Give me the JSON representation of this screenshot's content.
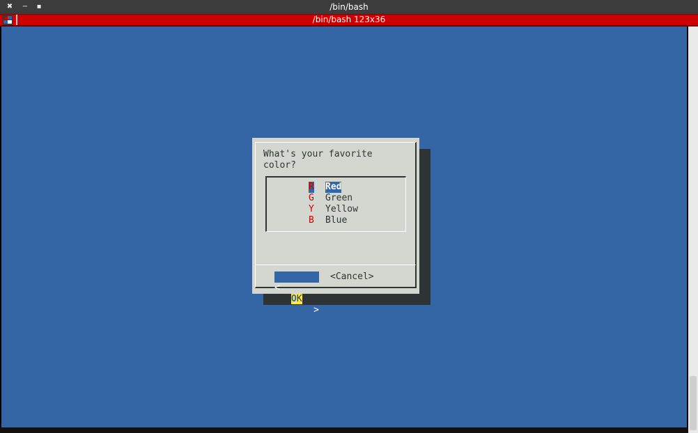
{
  "window": {
    "title": "/bin/bash",
    "close_glyph": "✖",
    "minimize_glyph": "−",
    "maximize_glyph": "▪"
  },
  "tab": {
    "title": "/bin/bash 123x36",
    "icon": "terminal-app-icon"
  },
  "colors": {
    "terminal_bg": "#3465a4",
    "dialog_bg": "#d3d7cf",
    "shadow": "#2e3436",
    "tab_bar": "#cc0000",
    "hotkey_fg": "#cc0000",
    "highlight": "#fce94f"
  },
  "dialog": {
    "prompt": "What's your favorite\ncolor?",
    "menu": [
      {
        "tag": "R",
        "label": "Red",
        "selected": true
      },
      {
        "tag": "G",
        "label": "Green",
        "selected": false
      },
      {
        "tag": "Y",
        "label": "Yellow",
        "selected": false
      },
      {
        "tag": "B",
        "label": "Blue",
        "selected": false
      }
    ],
    "buttons": {
      "ok": {
        "open": "<",
        "hotkey": "O",
        "rest": "K",
        "close": ">"
      },
      "cancel": "<Cancel>"
    }
  }
}
